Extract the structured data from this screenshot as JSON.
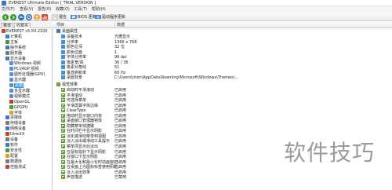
{
  "window": {
    "title": "EVEREST Ultimate Edition  [ TRIAL VERSION ]"
  },
  "menu": [
    {
      "label": "文件(F)",
      "name": "menu-file"
    },
    {
      "label": "查看(V)",
      "name": "menu-view"
    },
    {
      "label": "报告(R)",
      "name": "menu-report"
    },
    {
      "label": "收藏(O)",
      "name": "menu-favorites"
    },
    {
      "label": "工具(T)",
      "name": "menu-tools"
    },
    {
      "label": "帮助(H)",
      "name": "menu-help"
    }
  ],
  "toolbar": {
    "report_label": "报告",
    "updates_label": "BIOS 更新",
    "drivers_label": "驱动程序更新"
  },
  "tabs": [
    {
      "label": "菜单",
      "active": false
    },
    {
      "label": "收藏夹",
      "active": true
    }
  ],
  "tree": [
    {
      "label": "EVEREST v5.50.2100",
      "indent": 0,
      "color": "#d33b2c",
      "selected": false
    },
    {
      "label": "计算机",
      "indent": 1,
      "color": "#3b78c9",
      "selected": false
    },
    {
      "label": "主板",
      "indent": 1,
      "color": "#3aa53a",
      "selected": false
    },
    {
      "label": "操作系统",
      "indent": 1,
      "color": "#3b78c9",
      "selected": false
    },
    {
      "label": "服务器",
      "indent": 1,
      "color": "#7a7a7a",
      "selected": false
    },
    {
      "label": "显示设备",
      "indent": 1,
      "color": "#3b78c9",
      "selected": false
    },
    {
      "label": "Windows 视频",
      "indent": 2,
      "color": "#5c8fd6",
      "selected": false
    },
    {
      "label": "PCI/AGP 视频",
      "indent": 2,
      "color": "#5c8fd6",
      "selected": false
    },
    {
      "label": "图形处理器(GPU)",
      "indent": 2,
      "color": "#5c8fd6",
      "selected": false
    },
    {
      "label": "显示器",
      "indent": 2,
      "color": "#5c8fd6",
      "selected": false
    },
    {
      "label": "桌面",
      "indent": 2,
      "color": "#5c8fd6",
      "selected": true
    },
    {
      "label": "多显示器",
      "indent": 2,
      "color": "#5c8fd6",
      "selected": false
    },
    {
      "label": "视频模式",
      "indent": 2,
      "color": "#5c8fd6",
      "selected": false
    },
    {
      "label": "OpenGL",
      "indent": 2,
      "color": "#d33b2c",
      "selected": false
    },
    {
      "label": "GPGPU",
      "indent": 2,
      "color": "#3aa53a",
      "selected": false
    },
    {
      "label": "字体",
      "indent": 2,
      "color": "#e0a020",
      "selected": false
    },
    {
      "label": "多媒体",
      "indent": 1,
      "color": "#3b78c9",
      "selected": false
    },
    {
      "label": "存储设备",
      "indent": 1,
      "color": "#7a7a7a",
      "selected": false
    },
    {
      "label": "网络设备",
      "indent": 1,
      "color": "#3b78c9",
      "selected": false
    },
    {
      "label": "DirectX",
      "indent": 1,
      "color": "#d33b2c",
      "selected": false
    },
    {
      "label": "设备",
      "indent": 1,
      "color": "#7a7a7a",
      "selected": false
    },
    {
      "label": "软件",
      "indent": 1,
      "color": "#3b78c9",
      "selected": false
    },
    {
      "label": "安全性",
      "indent": 1,
      "color": "#3aa53a",
      "selected": false
    },
    {
      "label": "配置",
      "indent": 1,
      "color": "#e0a020",
      "selected": false
    },
    {
      "label": "数据库",
      "indent": 1,
      "color": "#7a7a7a",
      "selected": false
    },
    {
      "label": "性能测试",
      "indent": 1,
      "color": "#d33b2c",
      "selected": false
    }
  ],
  "columns": {
    "item": "项目",
    "value": "数据"
  },
  "groups": [
    {
      "label": "桌面属性",
      "rows": [
        {
          "label": "设备技术",
          "value": "光栅显示"
        },
        {
          "label": "分辨率",
          "value": "1366 x 768"
        },
        {
          "label": "颜色位深",
          "value": "32 位"
        },
        {
          "label": "颜色位面",
          "value": "1"
        },
        {
          "label": "字体分辨率",
          "value": "96 dpi"
        },
        {
          "label": "像素宽/高",
          "value": "36 / 36"
        },
        {
          "label": "像素对角线",
          "value": "51"
        },
        {
          "label": "垂直刷新率",
          "value": "60 Hz"
        },
        {
          "label": "桌面背景",
          "value": "C:\\Users\\chen\\AppData\\Roaming\\Microsoft\\Windows\\Themes\\..."
        }
      ]
    },
    {
      "label": "视觉效果",
      "rows": [
        {
          "label": "启动时平滑滚动",
          "value": "已启用"
        },
        {
          "label": "平滑滚动",
          "value": "已启用"
        },
        {
          "label": "可选择菜单",
          "value": "已启用"
        },
        {
          "label": "平滑屏幕字体边缘",
          "value": "已启用"
        },
        {
          "label": "ClearType",
          "value": "已启用"
        },
        {
          "label": "拖动时显示窗口内容",
          "value": "已启用"
        },
        {
          "label": "桌面窗口管理器特效",
          "value": "已启用"
        },
        {
          "label": "隐藏菜单快捷键",
          "value": "已启用"
        },
        {
          "label": "在时间栏中显示阴影",
          "value": "已启用"
        },
        {
          "label": "淡化或滑动菜单到视图",
          "value": "已启用"
        },
        {
          "label": "淡入淡出或滑动工具提示",
          "value": "已启用"
        },
        {
          "label": "菜单项显示后淡出",
          "value": "已启用"
        },
        {
          "label": "在鼠标指针下显示阴影",
          "value": "已启用"
        },
        {
          "label": "在窗口下显示阴影",
          "value": "已启用"
        },
        {
          "label": "在最大化和最小化时动画窗口",
          "value": "已启用"
        },
        {
          "label": "在桌面上为图标标签使用阴影",
          "value": "已启用"
        },
        {
          "label": "淡入淡出效果",
          "value": "已启用"
        },
        {
          "label": "声音描述",
          "value": "已禁用"
        }
      ]
    }
  ],
  "watermark": "软件技巧"
}
